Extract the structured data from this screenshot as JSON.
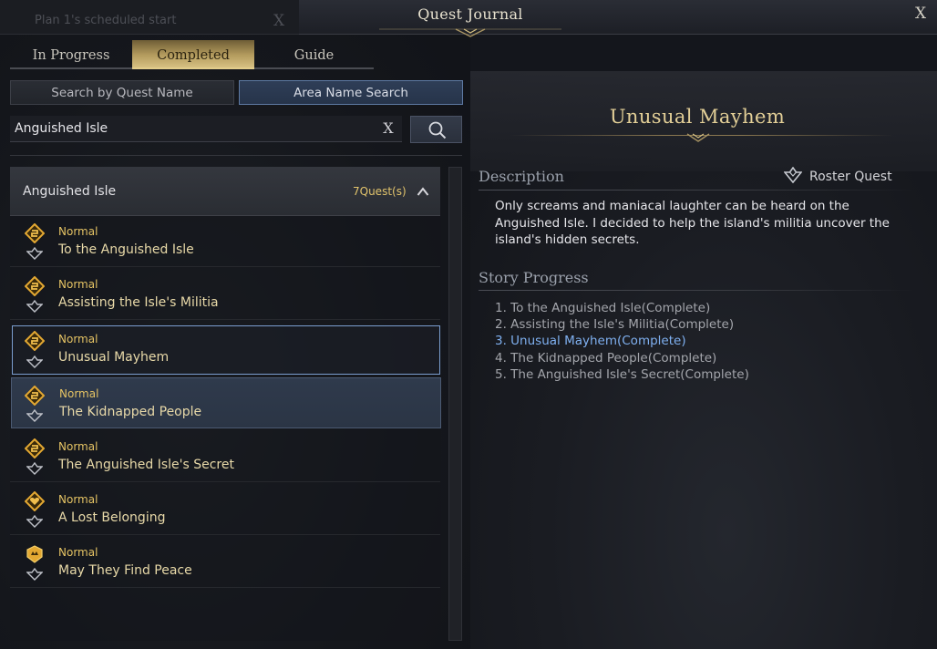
{
  "ghost_tab": {
    "label": "Plan 1's scheduled start"
  },
  "window": {
    "title": "Quest Journal"
  },
  "tabs": [
    {
      "label": "In Progress",
      "active": false
    },
    {
      "label": "Completed",
      "active": true
    },
    {
      "label": "Guide",
      "active": false
    }
  ],
  "search_modes": [
    {
      "label": "Search by Quest Name",
      "active": false
    },
    {
      "label": "Area Name Search",
      "active": true
    }
  ],
  "search": {
    "value": "Anguished Isle"
  },
  "group": {
    "name": "Anguished Isle",
    "count": "7Quest(s)"
  },
  "quests": [
    {
      "type": "Normal",
      "name": "To the Anguished Isle"
    },
    {
      "type": "Normal",
      "name": "Assisting the Isle's Militia"
    },
    {
      "type": "Normal",
      "name": "Unusual Mayhem"
    },
    {
      "type": "Normal",
      "name": "The Kidnapped People"
    },
    {
      "type": "Normal",
      "name": "The Anguished Isle's Secret"
    },
    {
      "type": "Normal",
      "name": "A Lost Belonging"
    },
    {
      "type": "Normal",
      "name": "May They Find Peace"
    }
  ],
  "detail": {
    "title": "Unusual Mayhem",
    "description_label": "Description",
    "roster_label": "Roster Quest",
    "description": "Only screams and maniacal laughter can be heard on the Anguished Isle. I decided to help the island's militia uncover the island's hidden secrets.",
    "story_label": "Story Progress",
    "story": [
      "1. To the Anguished Isle(Complete)",
      "2. Assisting the Isle's Militia(Complete)",
      "3. Unusual Mayhem(Complete)",
      "4. The Kidnapped People(Complete)",
      "5. The Anguished Isle's Secret(Complete)"
    ]
  },
  "colors": {
    "accent_gold": "#e2c46c",
    "selected_border": "#7b9ed0",
    "current_story": "#7fb0f0"
  }
}
